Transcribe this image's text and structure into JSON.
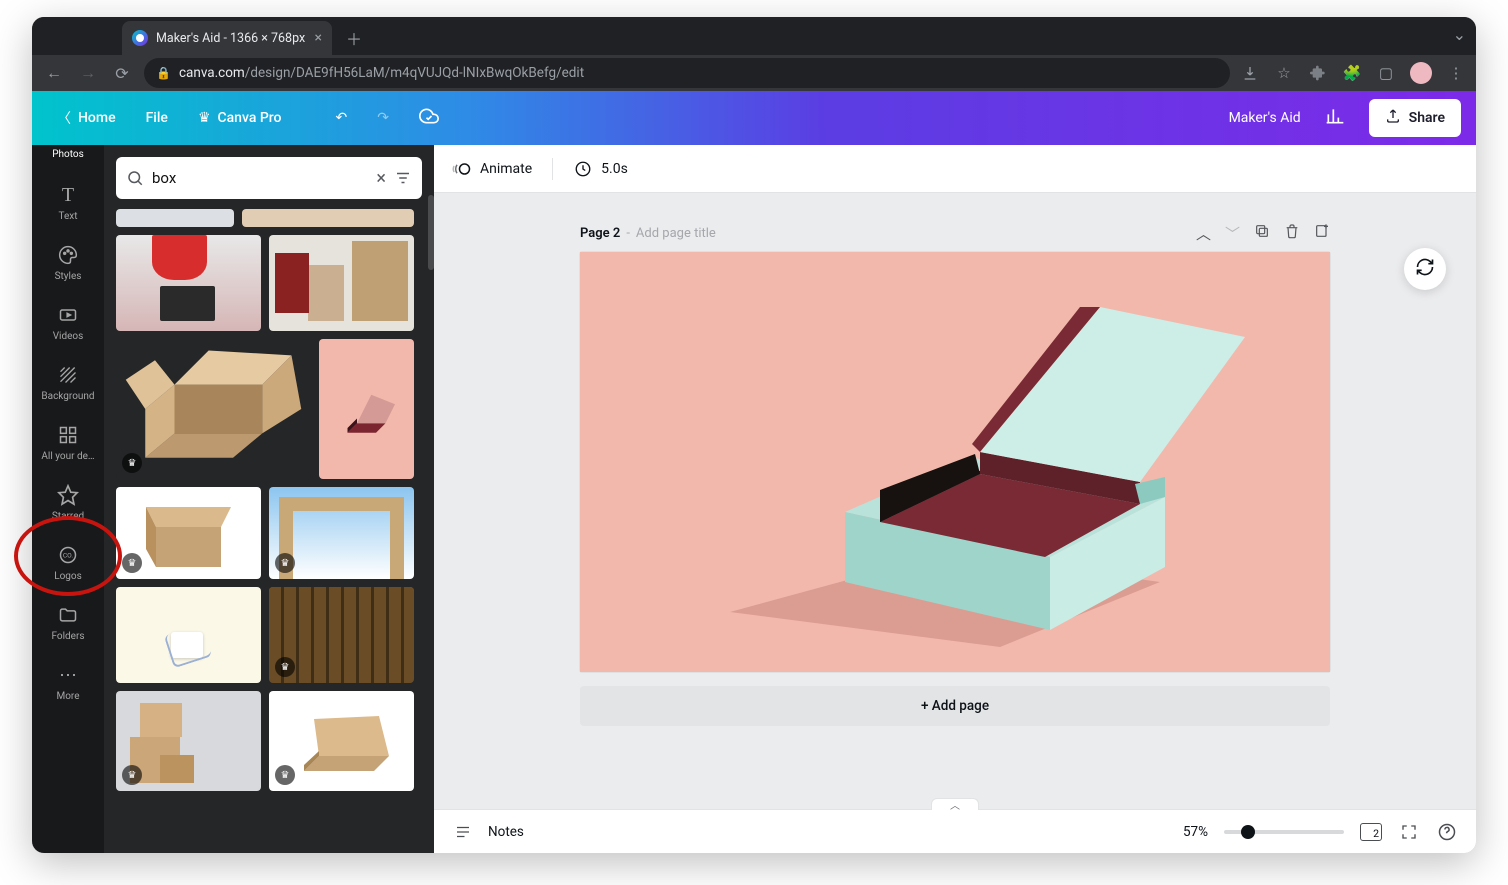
{
  "browser": {
    "tab_title": "Maker's Aid - 1366 × 768px",
    "url_host": "canva.com",
    "url_path": "/design/DAE9fH56LaM/m4qVUJQd-lNIxBwqOkBefg/edit"
  },
  "header": {
    "home": "Home",
    "file": "File",
    "canva_pro": "Canva Pro",
    "design_name": "Maker's Aid",
    "share": "Share"
  },
  "rail": {
    "items": [
      "Photos",
      "Text",
      "Styles",
      "Videos",
      "Background",
      "All your de…",
      "Starred",
      "Logos",
      "Folders",
      "More"
    ]
  },
  "search": {
    "value": "box",
    "placeholder": "Search"
  },
  "canvas_toolbar": {
    "animate": "Animate",
    "duration": "5.0s"
  },
  "page_header": {
    "page_label": "Page 2",
    "separator": " - ",
    "add_title_hint": "Add page title"
  },
  "add_page": "+ Add page",
  "footer": {
    "notes": "Notes",
    "zoom_pct": "57%",
    "zoom_value": 57,
    "page_count": "2"
  },
  "colors": {
    "canvas_bg": "#f3b8ac",
    "accent_gradient_start": "#00c4cc",
    "accent_gradient_end": "#7d2ae8"
  }
}
